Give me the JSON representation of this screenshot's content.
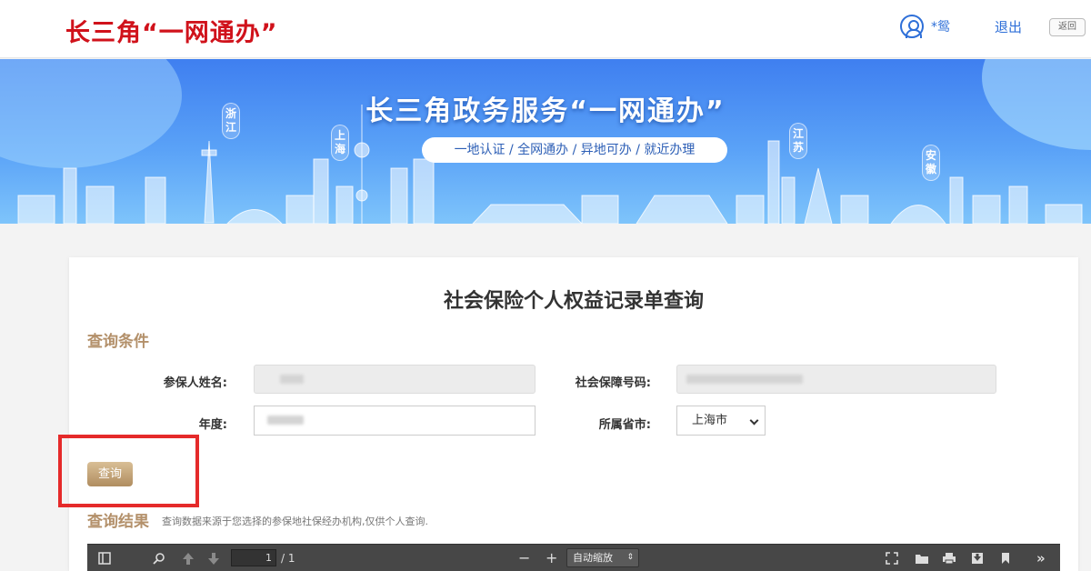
{
  "header": {
    "logo": "长三角“一网通办”",
    "user_name": "*鸳",
    "logout": "退出",
    "back": "返回"
  },
  "banner": {
    "title": "长三角政务服务“一网通办”",
    "subtitle": "一地认证 / 全网通办 / 异地可办 / 就近办理",
    "provinces": [
      "浙江",
      "上海",
      "江苏",
      "安徽"
    ]
  },
  "form": {
    "page_title": "社会保险个人权益记录单查询",
    "conditions_title": "查询条件",
    "name_label": "参保人姓名:",
    "ssn_label": "社会保障号码:",
    "year_label": "年度:",
    "province_label": "所属省市:",
    "province_value": "上海市",
    "query_button": "查询"
  },
  "result": {
    "title": "查询结果",
    "note": "查询数据来源于您选择的参保地社保经办机构,仅供个人查询."
  },
  "pdf_toolbar": {
    "page_current": "1",
    "page_total": "/ 1",
    "zoom_minus": "−",
    "zoom_plus": "+",
    "zoom_value": "自动缩放"
  },
  "colors": {
    "logo_red": "#d0121b",
    "link_blue": "#2e6fd8",
    "accent_gold": "#b3906a",
    "highlight_red": "#e52a2a"
  }
}
